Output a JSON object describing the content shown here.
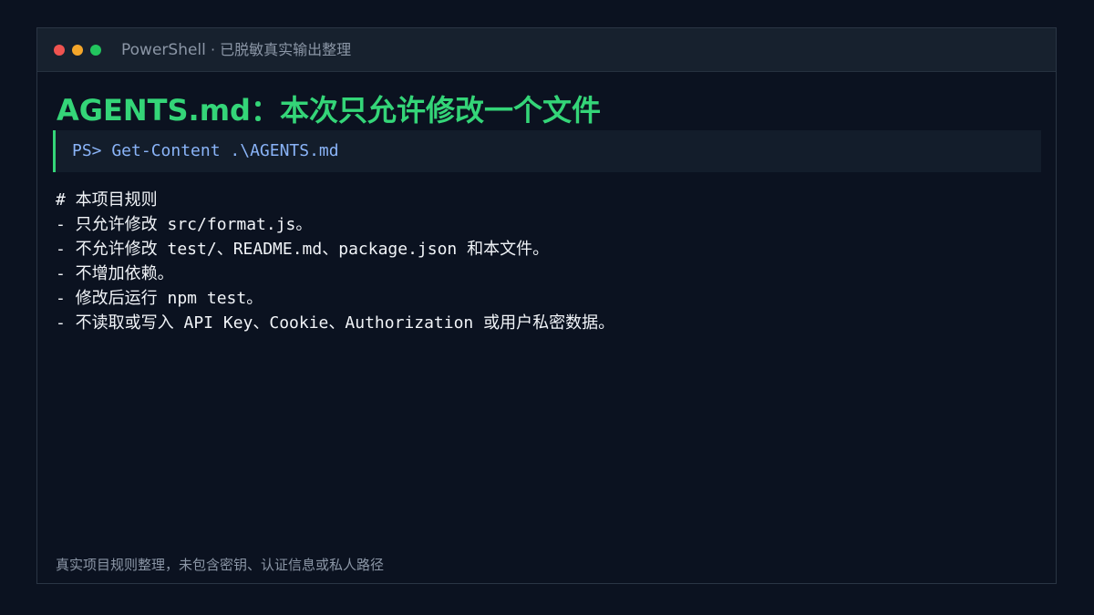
{
  "window": {
    "app_name": "PowerShell",
    "subtitle": " · 已脱敏真实输出整理",
    "colors": {
      "close": "#ef5350",
      "minimize": "#f4a62a",
      "maximize": "#22c55e"
    }
  },
  "heading": "AGENTS.md：本次只允许修改一个文件",
  "command": "PS> Get-Content .\\AGENTS.md",
  "output_lines": [
    "# 本项目规则",
    "- 只允许修改 src/format.js。",
    "- 不允许修改 test/、README.md、package.json 和本文件。",
    "- 不增加依赖。",
    "- 修改后运行 npm test。",
    "- 不读取或写入 API Key、Cookie、Authorization 或用户私密数据。"
  ],
  "footer": "真实项目规则整理，未包含密钥、认证信息或私人路径",
  "theme": {
    "accent": "#34d578",
    "command_color": "#8ab4f8",
    "background": "#0b1220"
  }
}
